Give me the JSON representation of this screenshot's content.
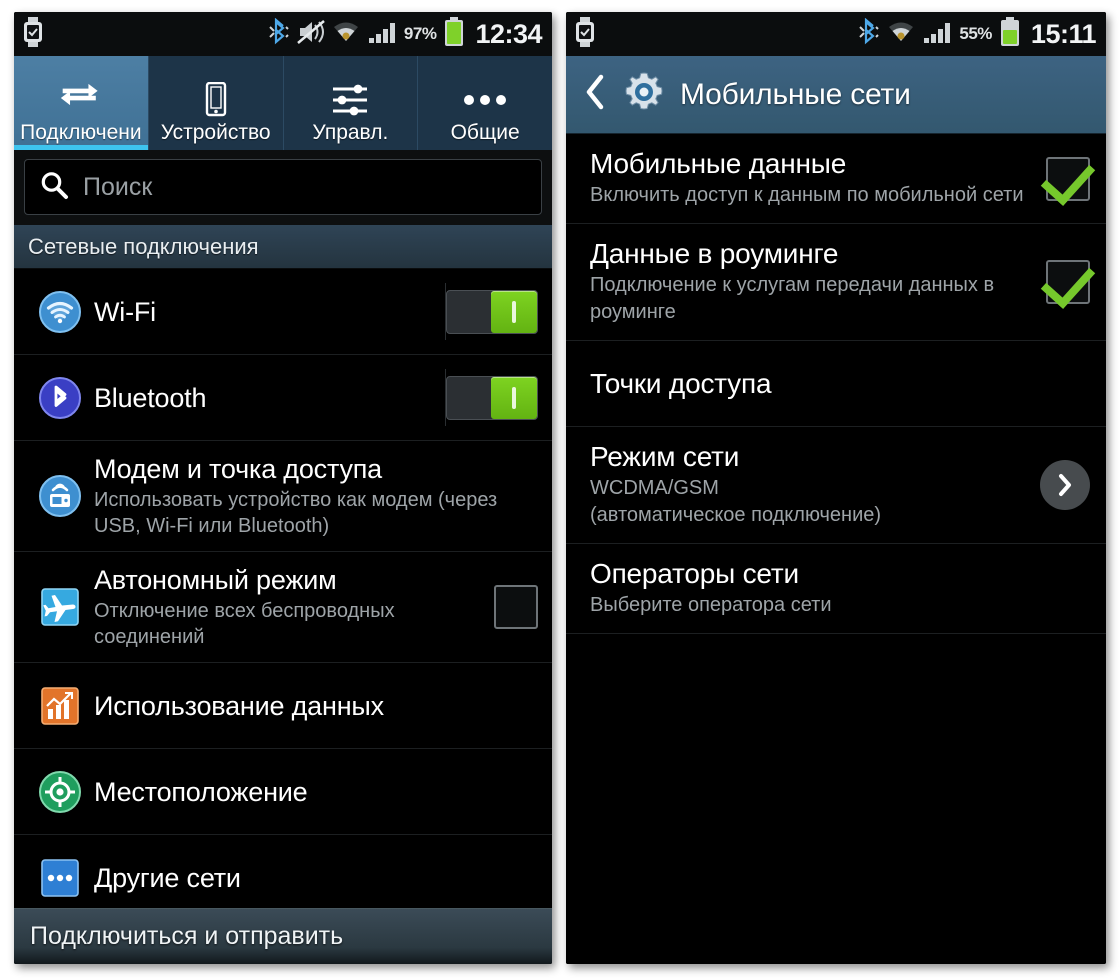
{
  "left_phone": {
    "status_bar": {
      "watch_icon": "smartwatch-icon",
      "bluetooth_icon": "bluetooth-icon",
      "mute_icon": "speaker-muted-icon",
      "wifi_icon": "wifi-icon",
      "signal_icon": "cellular-signal-icon",
      "battery_percent": "97%",
      "battery_icon": "battery-icon",
      "clock": "12:34"
    },
    "tabs": [
      {
        "label": "Подключени",
        "icon": "connections-arrows-icon",
        "active": true
      },
      {
        "label": "Устройство",
        "icon": "device-phone-icon",
        "active": false
      },
      {
        "label": "Управл.",
        "icon": "sliders-controls-icon",
        "active": false
      },
      {
        "label": "Общие",
        "icon": "more-dots-icon",
        "active": false
      }
    ],
    "search": {
      "placeholder": "Поиск",
      "icon": "search-icon"
    },
    "section_header": "Сетевые подключения",
    "items": [
      {
        "title": "Wi-Fi",
        "subtitle": "",
        "icon": "wifi-round-icon",
        "control": "toggle",
        "state": "on"
      },
      {
        "title": "Bluetooth",
        "subtitle": "",
        "icon": "bluetooth-round-icon",
        "control": "toggle",
        "state": "on"
      },
      {
        "title": "Модем и точка доступа",
        "subtitle": "Использовать устройство как модем (через USB, Wi-Fi или Bluetooth)",
        "icon": "tethering-hotspot-icon",
        "control": "none",
        "state": ""
      },
      {
        "title": "Автономный режим",
        "subtitle": "Отключение всех беспроводных соединений",
        "icon": "airplane-icon",
        "control": "checkbox",
        "state": "off"
      },
      {
        "title": "Использование данных",
        "subtitle": "",
        "icon": "data-usage-chart-icon",
        "control": "none",
        "state": ""
      },
      {
        "title": "Местоположение",
        "subtitle": "",
        "icon": "location-target-icon",
        "control": "none",
        "state": ""
      },
      {
        "title": "Другие сети",
        "subtitle": "",
        "icon": "more-networks-icon",
        "control": "none",
        "state": ""
      }
    ],
    "bottom_bar": "Подключиться и отправить"
  },
  "right_phone": {
    "status_bar": {
      "watch_icon": "smartwatch-icon",
      "bluetooth_icon": "bluetooth-icon",
      "wifi_icon": "wifi-icon",
      "signal_icon": "cellular-signal-icon",
      "battery_percent": "55%",
      "battery_icon": "battery-icon",
      "clock": "15:11"
    },
    "action_bar": {
      "back_icon": "back-chevron-icon",
      "app_icon": "settings-gear-icon",
      "title": "Мобильные сети"
    },
    "items": [
      {
        "title": "Мобильные данные",
        "subtitle": "Включить доступ к данным по мобильной сети",
        "control": "checkbox",
        "state": "on"
      },
      {
        "title": "Данные в роуминге",
        "subtitle": "Подключение к услугам передачи данных в роуминге",
        "control": "checkbox",
        "state": "on"
      },
      {
        "title": "Точки доступа",
        "subtitle": "",
        "control": "none",
        "state": ""
      },
      {
        "title": "Режим сети",
        "subtitle": "WCDMA/GSM\n(автоматическое подключение)",
        "control": "chevron",
        "state": ""
      },
      {
        "title": "Операторы сети",
        "subtitle": "Выберите оператора сети",
        "control": "none",
        "state": ""
      }
    ]
  },
  "colors": {
    "accent_blue": "#3d6382",
    "tab_active": "#4d7fa4",
    "tab_inactive": "#1d3448",
    "underline_cyan": "#3ec4ef",
    "toggle_green": "#7ed321",
    "check_green": "#76c82c",
    "background": "#000000"
  }
}
